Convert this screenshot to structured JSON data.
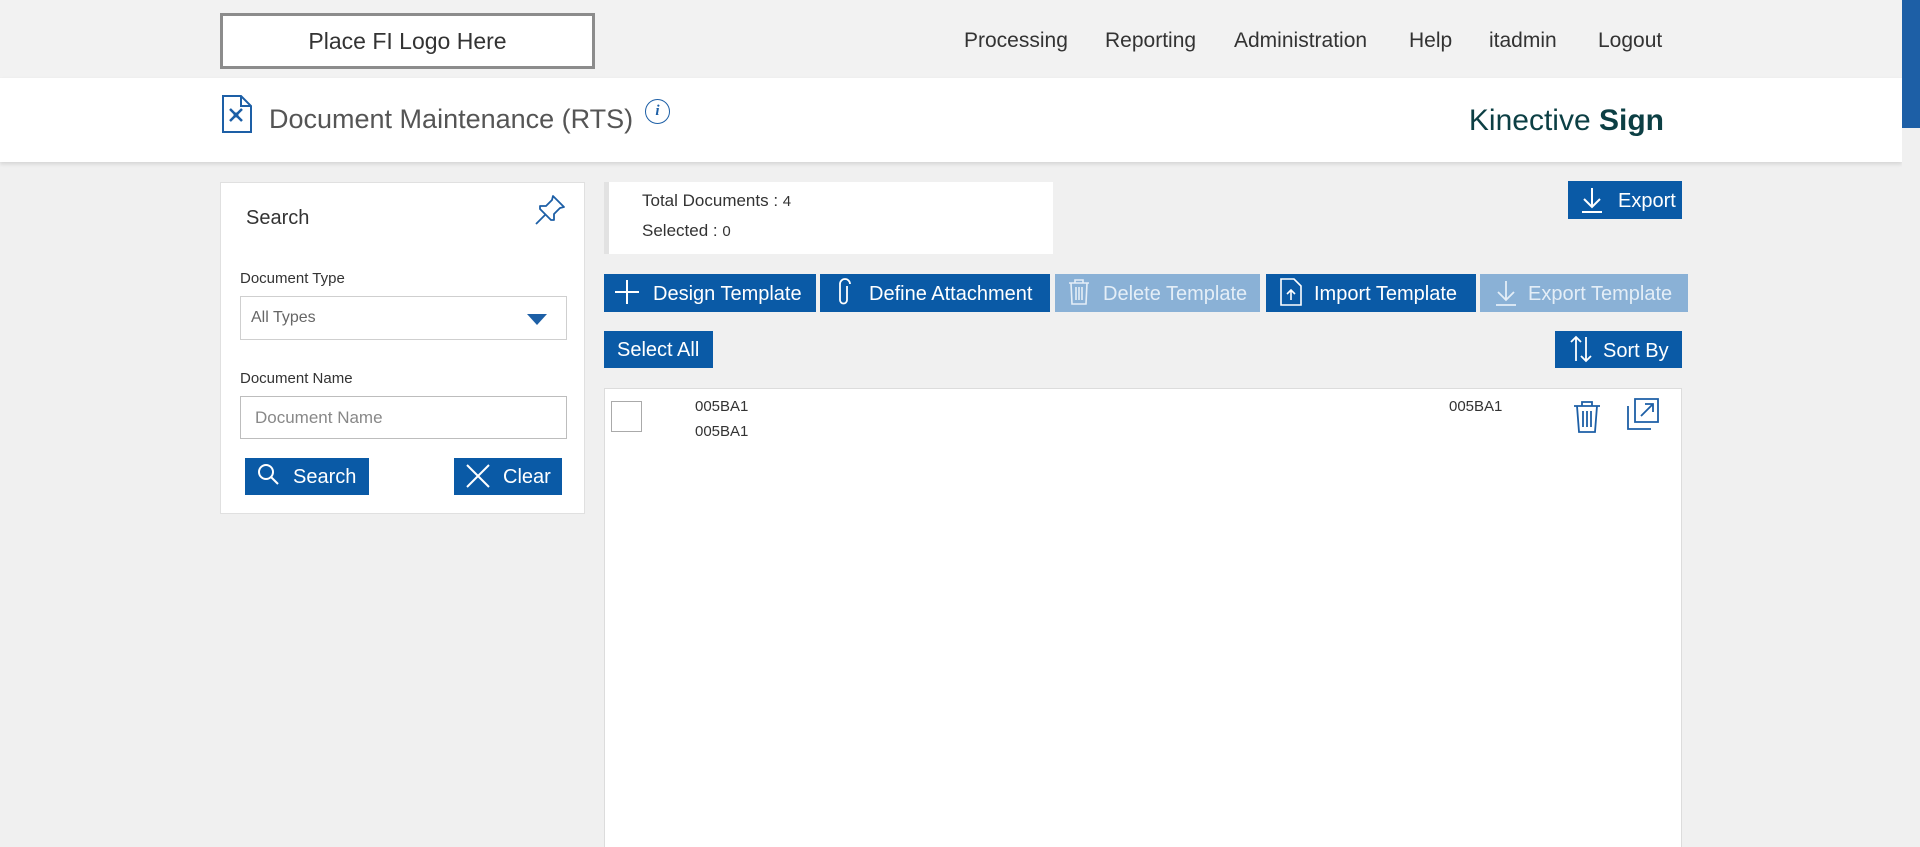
{
  "header": {
    "logo_text": "Place FI Logo Here",
    "nav": [
      "Processing",
      "Reporting",
      "Administration",
      "Help",
      "itadmin",
      "Logout"
    ]
  },
  "titlebar": {
    "page_title": "Document Maintenance (RTS)",
    "info_label": "i",
    "brand_light": "Kinective ",
    "brand_bold": "Sign"
  },
  "search": {
    "title": "Search",
    "doc_type_label": "Document Type",
    "doc_type_value": "All Types",
    "doc_name_label": "Document Name",
    "doc_name_placeholder": "Document Name",
    "search_button": "Search",
    "clear_button": "Clear"
  },
  "summary": {
    "total_label": "Total Documents : ",
    "total_value": "4",
    "selected_label": "Selected : ",
    "selected_value": "0"
  },
  "toolbar": {
    "export": "Export",
    "design_template": "Design Template",
    "define_attachment": "Define Attachment",
    "delete_template": "Delete Template",
    "import_template": "Import Template",
    "export_template": "Export Template",
    "select_all": "Select All",
    "sort_by": "Sort By"
  },
  "documents": [
    {
      "name": "005BA1",
      "description": "005BA1",
      "type": "005BA1"
    }
  ],
  "colors": {
    "primary": "#0a5aa6",
    "disabled": "#8ab1d6",
    "brand": "#0c3f44"
  }
}
